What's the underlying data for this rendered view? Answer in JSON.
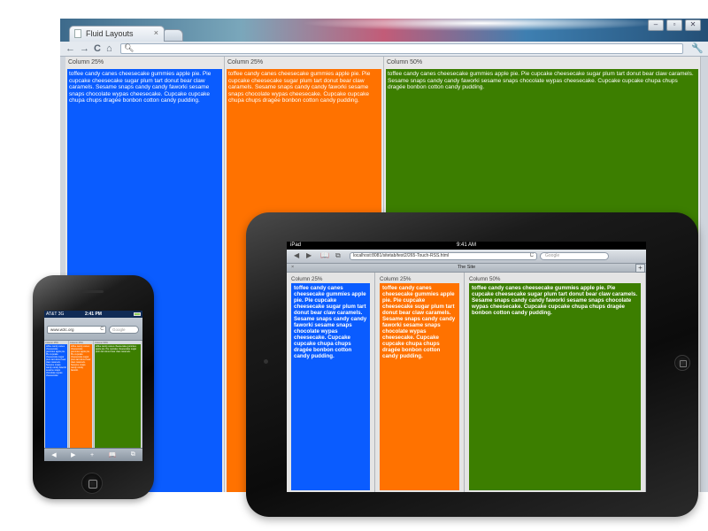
{
  "colors": {
    "blue": "#0a5cff",
    "orange": "#ff7200",
    "green": "#3c7e00"
  },
  "desktop": {
    "tab_title": "Fluid Layouts",
    "tab_close": "×",
    "nav": {
      "back": "←",
      "forward": "→",
      "reload": "C",
      "home": "⌂",
      "wrench": "🔧"
    },
    "window_controls": [
      "–",
      "▫",
      "✕"
    ],
    "columns": [
      {
        "heading": "Column 25%",
        "color": "blue",
        "text": "toffee candy canes cheesecake gummies apple pie. Pie cupcake cheesecake sugar plum tart donut bear claw caramels. Sesame snaps candy candy faworki sesame snaps chocolate wypas cheesecake. Cupcake cupcake chupa chups dragée bonbon cotton candy pudding."
      },
      {
        "heading": "Column 25%",
        "color": "orange",
        "text": "toffee candy canes cheesecake gummies apple pie. Pie cupcake cheesecake sugar plum tart donut bear claw caramels. Sesame snaps candy candy faworki sesame snaps chocolate wypas cheesecake. Cupcake cupcake chupa chups dragée bonbon cotton candy pudding."
      },
      {
        "heading": "Column 50%",
        "color": "green",
        "text": "toffee candy canes cheesecake gummies apple pie. Pie cupcake cheesecake sugar plum tart donut bear claw caramels. Sesame snaps candy candy faworki sesame snaps chocolate wypas cheesecake. Cupcake cupcake chupa chups dragée bonbon cotton candy pudding."
      }
    ]
  },
  "ipad": {
    "status": {
      "left": "iPad",
      "time": "9:41 AM"
    },
    "toolbar": {
      "back": "◀",
      "forward": "▶",
      "bookmarks": "📖",
      "share": "⧉"
    },
    "url": "localhost:8081/sitetab/test2/265-Touch-RSS.html",
    "reload": "C",
    "search_placeholder": "Google",
    "page_title": "The Site",
    "tab_close": "×",
    "new_tab": "+",
    "columns": [
      {
        "heading": "Column 25%",
        "color": "blue",
        "text": "toffee candy canes cheesecake gummies apple pie. Pie cupcake cheesecake sugar plum tart donut bear claw caramels. Sesame snaps candy candy faworki sesame snaps chocolate wypas cheesecake. Cupcake cupcake chupa chups dragée bonbon cotton candy pudding."
      },
      {
        "heading": "Column 25%",
        "color": "orange",
        "text": "toffee candy canes cheesecake gummies apple pie. Pie cupcake cheesecake sugar plum tart donut bear claw caramels. Sesame snaps candy candy faworki sesame snaps chocolate wypas cheesecake. Cupcake cupcake chupa chups dragée bonbon cotton candy pudding."
      },
      {
        "heading": "Column 50%",
        "color": "green",
        "text": "toffee candy canes cheesecake gummies apple pie. Pie cupcake cheesecake sugar plum tart donut bear claw caramels. Sesame snaps candy candy faworki sesame snaps chocolate wypas cheesecake. Cupcake cupcake chupa chups dragée bonbon cotton candy pudding."
      }
    ]
  },
  "iphone": {
    "status": {
      "carrier": "AT&T 3G",
      "time": "2:41 PM"
    },
    "url": "www.w3c.org",
    "reload": "C",
    "search_placeholder": "Google",
    "bottom_bar": [
      "◀",
      "▶",
      "+",
      "📖",
      "⧉"
    ],
    "columns": [
      {
        "heading": "Column 25%",
        "color": "blue",
        "text": "toffee candy canes cheesecake gummies apple pie. Pie cupcake cheesecake sugar plum tart donut bear claw caramels. Sesame snaps candy candy faworki sesame snaps chocolate wypas cheesecake."
      },
      {
        "heading": "Column 25%",
        "color": "orange",
        "text": "toffee candy canes cheesecake gummies apple pie. Pie cupcake cheesecake sugar plum tart donut bear claw caramels. Sesame snaps candy candy faworki."
      },
      {
        "heading": "Column 50%",
        "color": "green",
        "text": "toffee candy canes cheesecake gummies apple pie. Pie cupcake cheesecake sugar plum tart donut bear claw caramels."
      }
    ]
  }
}
